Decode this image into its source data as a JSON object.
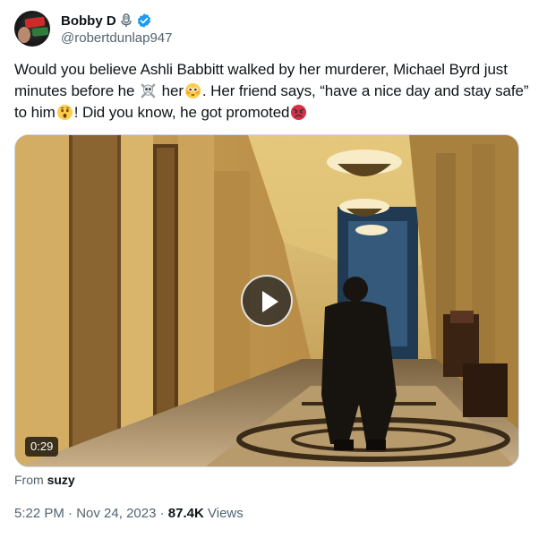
{
  "author": {
    "display_name": "Bobby D",
    "handle": "@robertdunlap947",
    "badges": [
      "microphone-icon",
      "verified-badge-icon"
    ],
    "avatar_icon": "avatar"
  },
  "tweet": {
    "segments": [
      "Would you believe Ashli Babbitt walked by her murderer, Michael Byrd just minutes before he ",
      " her",
      ". Her friend says, “have a nice day and stay safe” to him",
      "! Did you know, he got promoted"
    ],
    "emojis": [
      "skull-crossbones-emoji",
      "flushed-face-emoji",
      "astonished-face-emoji",
      "angry-face-emoji"
    ]
  },
  "media": {
    "duration": "0:29",
    "play_icon": "play-icon"
  },
  "source": {
    "prefix": "From",
    "name": "suzy"
  },
  "meta": {
    "time": "5:22 PM",
    "separator": "·",
    "date": "Nov 24, 2023",
    "views_count": "87.4K",
    "views_label": "Views"
  },
  "colors": {
    "text_primary": "#0f1419",
    "text_secondary": "#536471",
    "verified_blue": "#1d9bf0",
    "border": "#cfd9de"
  }
}
